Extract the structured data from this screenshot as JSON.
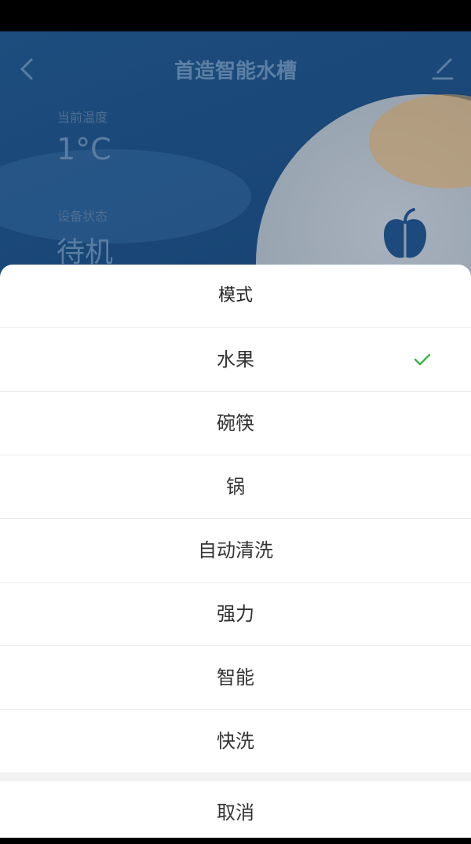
{
  "header": {
    "title": "首造智能水槽",
    "back_icon": "chevron-left-icon",
    "edit_icon": "edit-icon"
  },
  "status": {
    "temp_label": "当前温度",
    "temp_value": "1°C",
    "device_label": "设备状态",
    "device_value": "待机",
    "mode_icon": "apple-icon"
  },
  "sheet": {
    "title": "模式",
    "options": [
      {
        "label": "水果",
        "selected": true
      },
      {
        "label": "碗筷",
        "selected": false
      },
      {
        "label": "锅",
        "selected": false
      },
      {
        "label": "自动清洗",
        "selected": false
      },
      {
        "label": "强力",
        "selected": false
      },
      {
        "label": "智能",
        "selected": false
      },
      {
        "label": "快洗",
        "selected": false
      }
    ],
    "cancel_label": "取消",
    "check_color": "#3bb54a"
  }
}
